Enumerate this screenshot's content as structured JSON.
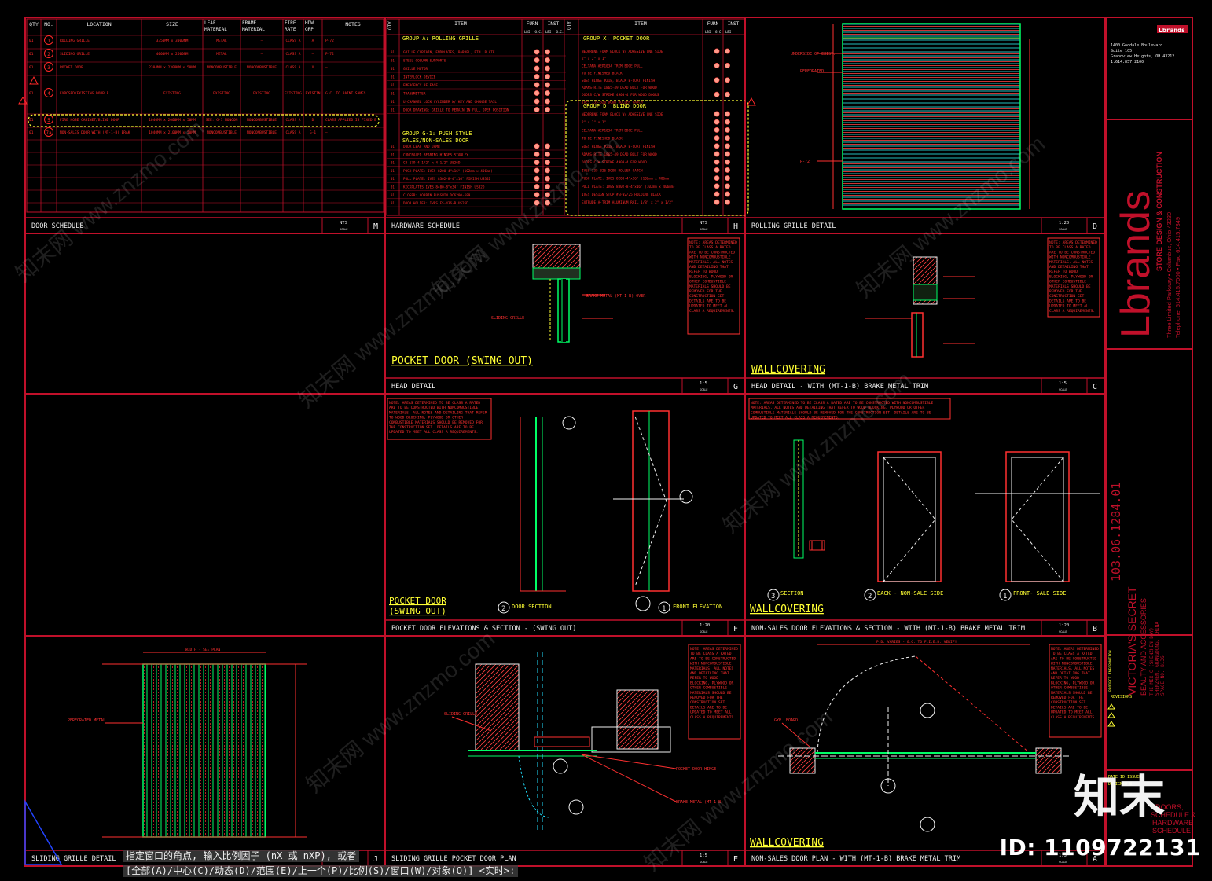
{
  "colors": {
    "frame": "#c0102a",
    "yellow": "#ffff33",
    "red": "#ff2828",
    "green": "#33ff55",
    "cyan": "#22e0ff",
    "white": "#f0f0f0",
    "hatch": "#00ff66"
  },
  "door_schedule": {
    "headers": [
      "QTY",
      "NO.",
      "LOCATION",
      "SIZE",
      "LEAF MATERIAL",
      "FRAME MATERIAL",
      "FIRE RATE",
      "HDW GRP",
      "NOTES"
    ],
    "rows": [
      [
        "01",
        "1",
        "ROLLING GRILLE",
        "3350MM x 3000MM",
        "METAL",
        "—",
        "CLASS A",
        "A",
        "P-72"
      ],
      [
        "01",
        "2",
        "SLIDING GRILLE",
        "4000MM x 2600MM",
        "METAL",
        "—",
        "CLASS A",
        "—",
        "P-72"
      ],
      [
        "01",
        "3",
        "POCKET DOOR",
        "2304MM x 2300MM x 50MM",
        "NONCOMBUSTIBLE",
        "NONCOMBUSTIBLE",
        "CLASS A",
        "X",
        "—"
      ],
      [
        "01",
        "4",
        "EXPOSED/EXISTING DOUBLE",
        "EXISTING",
        "EXISTING",
        "EXISTING",
        "EXISTING",
        "EXISTING",
        "G.C. TO PAINT SAMES"
      ],
      [
        "01",
        "5",
        "FIRE HOSE CABINET/BLIND DOOR",
        "1040MM x 2000MM x 50MM",
        "SEE: G-1 NONCOMBUSTIBLE",
        "NONCOMBUSTIBLE",
        "CLASS A",
        "D",
        "CLASS APPLIED IS FIXED BY GC"
      ],
      [
        "01",
        "7a",
        "NON-SALES DOOR WITH (MT-1-B) BRAKE METAL TRIM",
        "1040MM x 2100MM x 50MM",
        "NONCOMBUSTIBLE",
        "NONCOMBUSTIBLE",
        "CLASS A",
        "G-1",
        "—"
      ]
    ]
  },
  "hardware_schedule": {
    "headers": [
      "QTY",
      "ITEM",
      "FURN",
      "INST"
    ],
    "sub_headers": [
      "LBI",
      "G.C.",
      "LBI",
      "G.C."
    ],
    "group_a": "GROUP A: ROLLING GRILLE",
    "group_x": "GROUP X: POCKET DOOR",
    "group_d": "GROUP D: BLIND DOOR",
    "group_g1_line1": "GROUP G-1: PUSH STYLE",
    "group_g1_line2": "SALES/NON-SALES DOOR",
    "left_items": [
      "GRILLE CURTAIN, ENDPLATES, BARREL, BTM. PLATE",
      "STEEL COLUMN SUPPORTS",
      "GRILLE MOTOR",
      "INTERLOCK DEVICE",
      "EMERGENCY RELEASE",
      "TRANSMITTER",
      "U-CHANNEL LOCK CYLINDER W/ KEY AND CHANGE TAIL",
      "DOOR DRAWING: GRILLE TO REMAIN IN FULL OPEN POSITION"
    ],
    "g1_items": [
      "DOOR LEAF AND JAMB",
      "CONCEALED BEARING HINGES STANLEY",
      "CB-179 4-1/2\" x 4-1/2\" US26D",
      "PUSH PLATE: IVES 8200-4\"x16\" (102mm x 406mm)",
      "PULL PLATE: IVES 8302-8-4\"x16\" FINISH US32D",
      "KICKPLATES IVES 8400-8\"x34\" FINISH US32D",
      "CLOSER: CORBIN RUSSWIN DC6200-689",
      "DOOR HOLDER: IVES FS-436-B-US26D"
    ],
    "right_items_x": [
      "NEOPRENE FOAM BLOCK W/ ADHESIVE ONE SIDE",
      "2\" x 2\" x 1\"",
      "CELTAMA #EP1034 TRIM EDGE PULL",
      "TO BE FINISHED BLACK",
      "SOSS HINGE #218, BLACK E-COAT FINISH",
      "ADAMS-RITE 1865-49 DEAD BOLT FOR WOOD",
      "DOORS C/W STRIKE 4900-4 FOR WOOD DOORS",
      "IVES 335-B26 DOOR ROLLER CATCH"
    ],
    "right_items_d": [
      "NEOPRENE FOAM BLOCK W/ ADHESIVE ONE SIDE",
      "2\" x 2\" x 1\"",
      "CELTAMA #EP1034 TRIM EDGE PULL",
      "TO BE FINISHED BLACK",
      "SOSS HINGE #218, BLACK E-COAT FINISH",
      "ADAMS-RITE 1865-49 DEAD BOLT FOR WOOD",
      "DOORS C/W STRIKE 4900-4 FOR WOOD",
      "IVES 335-B26 DOOR ROLLER CATCH",
      "PUSH PLATE: IVES 8200-4\"x16\" (102mm x 406mm)",
      "PULL PLATE: IVES 8302-8-4\"x16\" (102mm x 406mm)",
      "IVES DESIGN STOP #EFW2/25 HOLDING BLACK",
      "EXTRUDE-A-TRIM ALUMINUM RAIL 1/8\" x 2\" x 1/2\""
    ]
  },
  "titles": {
    "M": {
      "label": "DOOR SCHEDULE",
      "scale": "NTS",
      "letter": "M"
    },
    "H": {
      "label": "HARDWARE SCHEDULE",
      "scale": "NTS",
      "letter": "H"
    },
    "D": {
      "label": "ROLLING GRILLE DETAIL",
      "scale": "1:20",
      "letter": "D"
    },
    "G": {
      "label": "HEAD DETAIL",
      "scale": "1:5",
      "letter": "G"
    },
    "C": {
      "label": "HEAD DETAIL - WITH (MT-1-B) BRAKE METAL TRIM",
      "scale": "1:5",
      "letter": "C"
    },
    "F": {
      "label": "POCKET DOOR ELEVATIONS & SECTION - (SWING OUT)",
      "scale": "1:20",
      "letter": "F"
    },
    "B": {
      "label": "NON-SALES DOOR ELEVATIONS & SECTION - WITH (MT-1-B) BRAKE METAL TRIM",
      "scale": "1:20",
      "letter": "B"
    },
    "J": {
      "label": "SLIDING GRILLE DETAIL",
      "scale": "",
      "letter": "J"
    },
    "E": {
      "label": "SLIDING GRILLE POCKET DOOR PLAN",
      "scale": "1:5",
      "letter": "E"
    },
    "A": {
      "label": "NON-SALES DOOR PLAN - WITH (MT-1-B) BRAKE METAL TRIM",
      "scale": "1:5",
      "letter": "A"
    }
  },
  "scale_sub": "SCALE",
  "labels": {
    "pocket_door_swing_out": "POCKET DOOR (SWING OUT)",
    "wallcovering": "WALLCOVERING",
    "pocket_door_l1": "POCKET DOOR",
    "pocket_door_l2": "(SWING OUT)",
    "door_section": "DOOR SECTION",
    "front_elevation": "FRONT ELEVATION",
    "section": "SECTION",
    "back_non_sale": "BACK - NON-SALE SIDE",
    "front_sale": "FRONT- SALE SIDE",
    "sliding_grille": "SLIDING GRILLE",
    "perforated_metal": "PERFORATED METAL",
    "brake_metal": "BRAKE METAL (MT-1-B)",
    "ops_board": "GYP. BOARD",
    "width_varies": "WIDTH - SEE PLAN",
    "door_hinge": "POCKET DOOR HINGE",
    "pd_varies": "P.D. VARIES - G.C. TO F.I.E.D. VERIFY"
  },
  "notes_block": "NOTE: AREAS DETERMINED TO BE CLASS A RATED ARE TO BE CONSTRUCTED WITH NONCOMBUSTIBLE MATERIALS. ALL NOTES AND DETAILING THAT REFER TO WOOD BLOCKING, PLYWOOD OR OTHER COMBUSTIBLE MATERIALS SHOULD BE REMOVED FOR THE CONSTRUCTION SET. DETAILS ARE TO BE UPDATED TO MEET ALL CLASS A REQUIREMENTS.",
  "title_block": {
    "company_small": "Lbrands",
    "addr1": "1400 Goodale Boulevard",
    "addr2": "Suite 105",
    "addr3": "Grandview Heights, OH 43212",
    "addr4": "1.614.857.2100",
    "brand": "Lbrands",
    "sub": "STORE DESIGN & CONSTRUCTION",
    "addr_line": "Three Limited Parkway • Columbus, Ohio 43230",
    "tel_line": "Telephone: 614.415.7000 • Fax: 614.415.7349",
    "project_no": "103.06.1284.01",
    "store_l1": "VICTORIA'S SECRET",
    "store_l2": "BEAUTY AND ACCESSORIES",
    "store_l3": "THE MIX C (SHENZHEN BAY)",
    "store_l4": "SHENZHEN, GUANGDONG, CHINA",
    "store_l5": "SPACE NO. B136",
    "project_info": "PROJECT INFORMATION",
    "revisions": "REVISIONS:",
    "date_issued": "DATE ID ISSUED:",
    "designed": "DESIGNED B",
    "sheet_l1": "DOORS,",
    "sheet_l2": "SCHEDULE &",
    "sheet_l3": "HARDWARE",
    "sheet_l4": "SCHEDULE"
  },
  "command_line1": "指定窗口的角点, 输入比例因子 (nX 或 nXP), 或者",
  "command_line2": "[全部(A)/中心(C)/动态(D)/范围(E)/上一个(P)/比例(S)/窗口(W)/对象(O)] <实时>:",
  "watermark_text": "知末网 www.znzmo.com",
  "watermark_logo": "知末",
  "watermark_id": "ID: 1109722131"
}
